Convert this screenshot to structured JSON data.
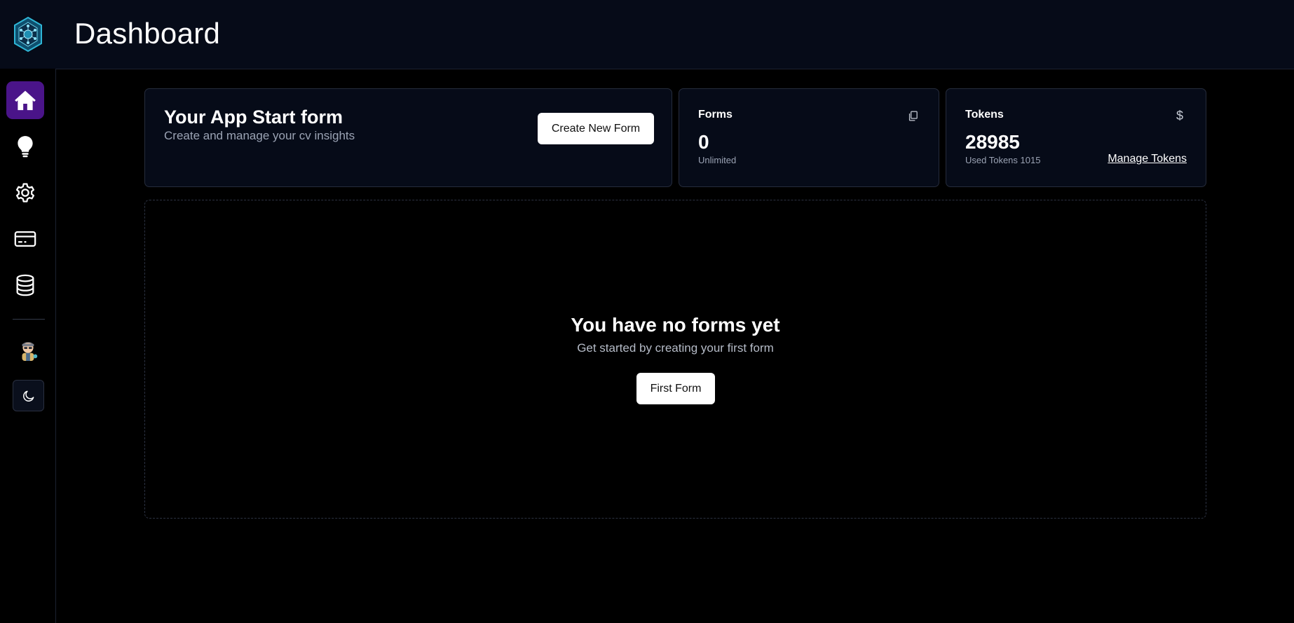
{
  "header": {
    "title": "Dashboard"
  },
  "sidebar": {
    "items": [
      {
        "name": "home",
        "icon": "home-icon",
        "active": true
      },
      {
        "name": "ideas",
        "icon": "lightbulb-icon",
        "active": false
      },
      {
        "name": "settings",
        "icon": "gear-icon",
        "active": false
      },
      {
        "name": "billing",
        "icon": "credit-card-icon",
        "active": false
      },
      {
        "name": "database",
        "icon": "database-icon",
        "active": false
      }
    ],
    "theme_toggle_icon": "moon-icon",
    "accent_color": "#4a1489"
  },
  "start_card": {
    "title": "Your App Start form",
    "subtitle": "Create and manage your cv insights",
    "button_label": "Create New Form"
  },
  "forms_card": {
    "label": "Forms",
    "value": "0",
    "sub": "Unlimited",
    "icon": "copy-icon"
  },
  "tokens_card": {
    "label": "Tokens",
    "value": "28985",
    "sub": "Used Tokens 1015",
    "link_label": "Manage Tokens",
    "icon": "dollar-icon",
    "icon_glyph": "$"
  },
  "empty_state": {
    "title": "You have no forms yet",
    "subtitle": "Get started by creating your first form",
    "button_label": "First Form"
  }
}
